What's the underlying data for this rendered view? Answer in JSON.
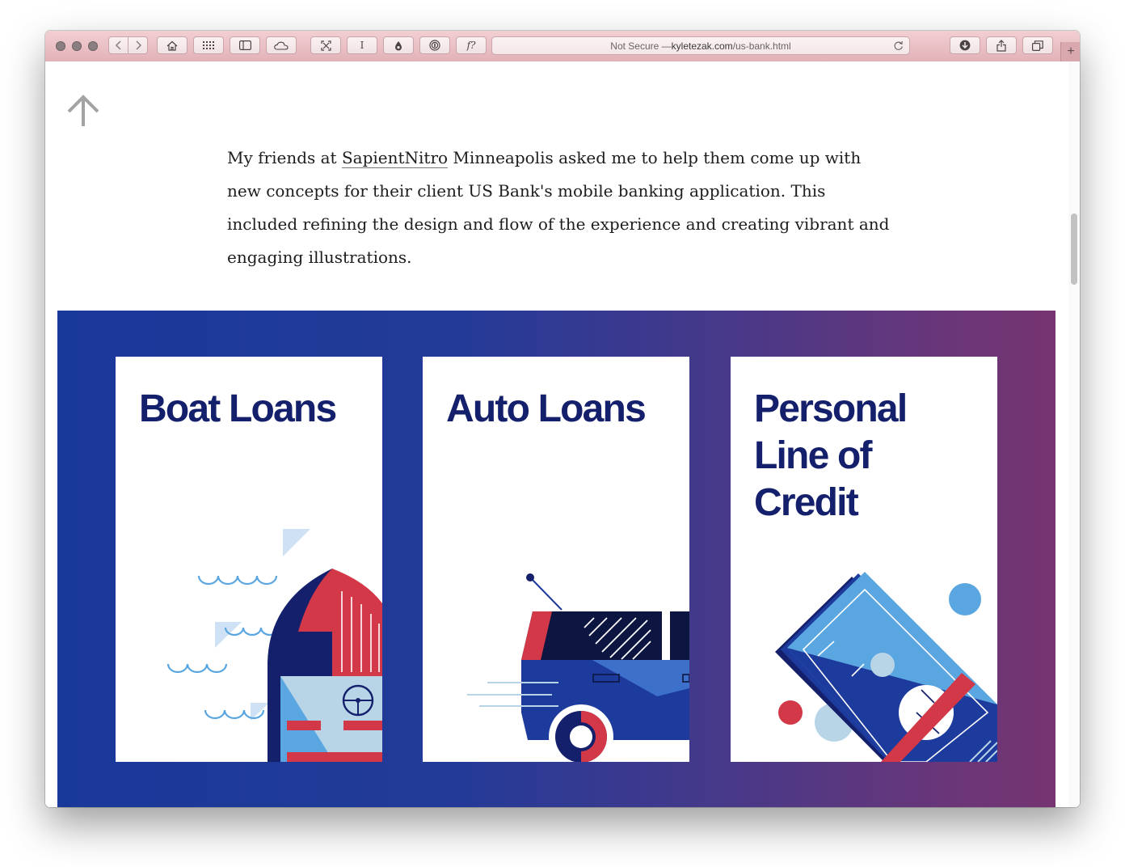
{
  "browser": {
    "url_prefix": "Not Secure — ",
    "url_host": "kyletezak.com",
    "url_path": "/us-bank.html",
    "new_tab": "+",
    "reader_label": "I",
    "font_label": "f?"
  },
  "page": {
    "intro_before": "My friends at ",
    "intro_link": "SapientNitro",
    "intro_after": " Minneapolis asked me to help them come up with new concepts for their client US Bank's mobile banking application. This included refining the design and flow of the experience and creating vibrant and engaging illustrations."
  },
  "cards": [
    {
      "title": "Boat Loans"
    },
    {
      "title": "Auto Loans"
    },
    {
      "title": "Personal Line of Credit"
    }
  ],
  "colors": {
    "navy": "#14206b",
    "blue": "#1d3b9c",
    "red": "#d23847",
    "light_blue": "#5aa6e0",
    "pale_blue": "#b8d5e8"
  }
}
